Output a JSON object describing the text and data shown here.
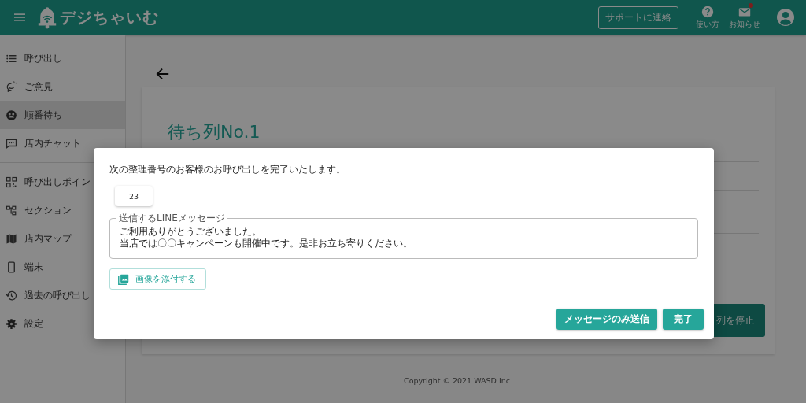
{
  "header": {
    "logo_text": "デジちゃいむ",
    "support_button": "サポートに連絡",
    "actions": [
      {
        "kind": "help",
        "label": "使い方",
        "badge": false
      },
      {
        "kind": "mail",
        "label": "お知らせ",
        "badge": true
      }
    ]
  },
  "sidebar": {
    "groups": [
      [
        {
          "label": "呼び出し",
          "selected": false
        },
        {
          "label": "ご意見",
          "selected": false
        },
        {
          "label": "順番待ち",
          "selected": true
        },
        {
          "label": "店内チャット",
          "selected": false
        }
      ],
      [
        {
          "label": "呼び出しポイン",
          "selected": false
        },
        {
          "label": "セクション",
          "selected": false
        },
        {
          "label": "店内マップ",
          "selected": false
        },
        {
          "label": "端末",
          "selected": false
        },
        {
          "label": "過去の呼び出し",
          "selected": false
        },
        {
          "label": "設定",
          "selected": false
        }
      ]
    ]
  },
  "page": {
    "title": "待ち列No.1",
    "stop_button": "列を停止"
  },
  "footer": "Copyright © 2021 WASD Inc.",
  "dialog": {
    "message": "次の整理番号のお客様のお呼び出しを完了いたします。",
    "number": "23",
    "line_message": {
      "label": "送信するLINEメッセージ",
      "lines": [
        "ご利用ありがとうございました。",
        "当店では〇〇キャンペーンも開催中です。是非お立ち寄りください。"
      ]
    },
    "attach_button": "画像を添付する",
    "buttons": [
      "メッセージのみ送信",
      "完了"
    ]
  }
}
